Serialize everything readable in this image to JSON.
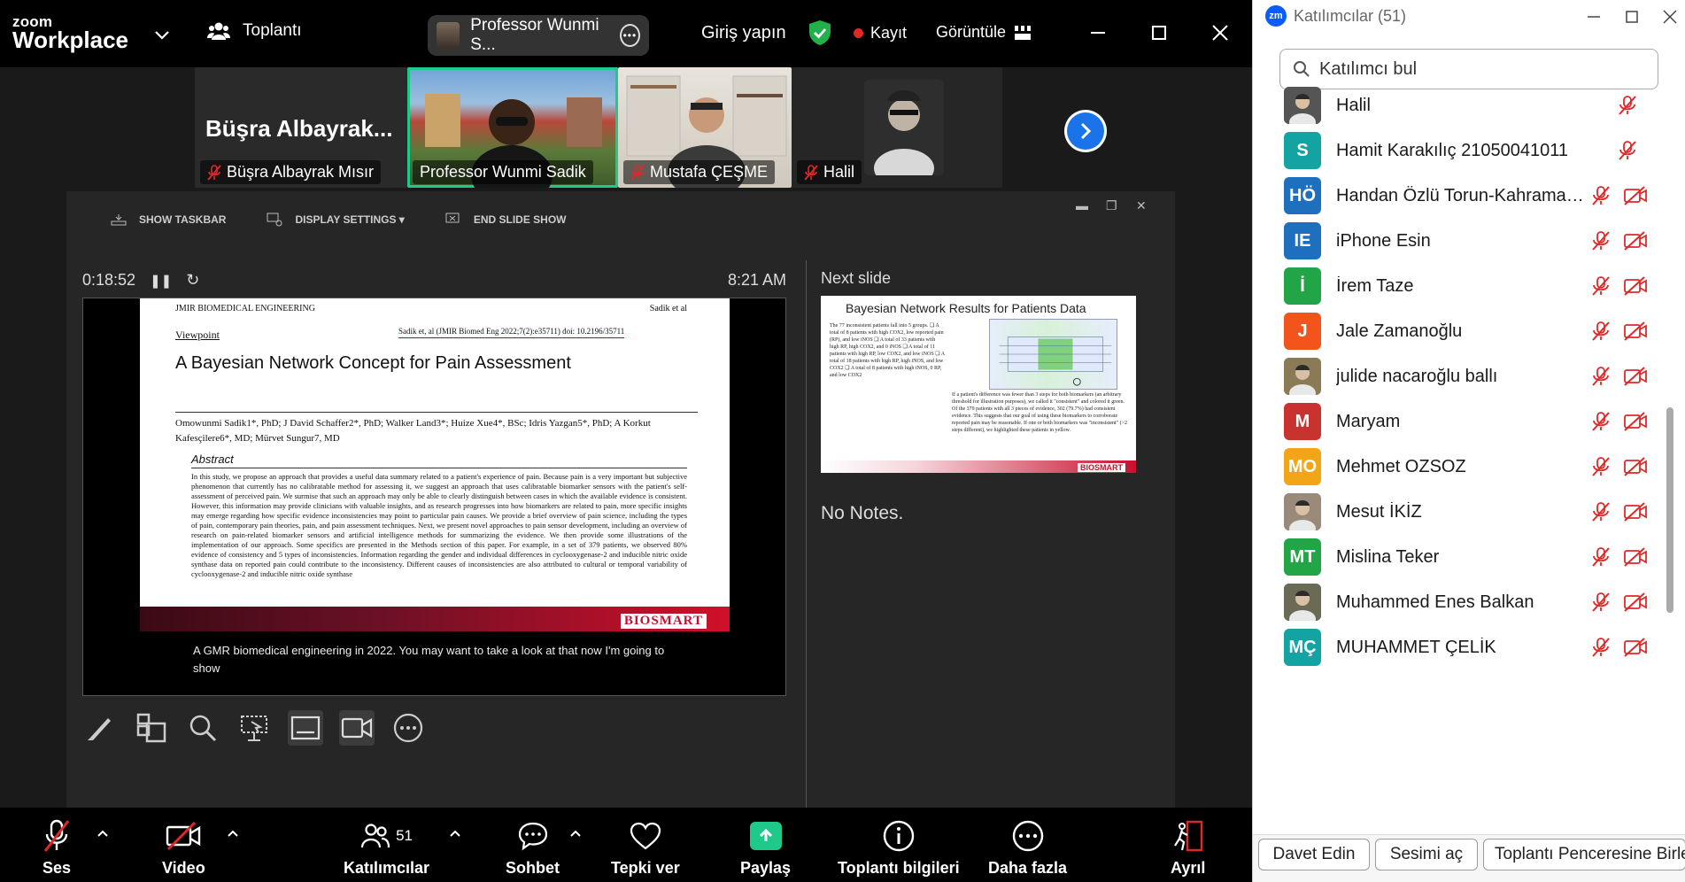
{
  "app": {
    "logo_line1": "zoom",
    "logo_line2": "Workplace",
    "meeting_label": "Toplantı",
    "speaker_pill": "Professor Wunmi S...",
    "signin": "Giriş yapın",
    "record": "Kayıt",
    "view": "Görüntüle"
  },
  "thumbnails": [
    {
      "big_name": "Büşra  Albayrak...",
      "label": "Büşra Albayrak Mısır",
      "muted": true
    },
    {
      "label": "Professor Wunmi Sadik",
      "muted": false,
      "active": true
    },
    {
      "label": "Mustafa ÇEŞME",
      "muted": true
    },
    {
      "label": "Halil",
      "muted": true
    }
  ],
  "presenter": {
    "toolbar": {
      "show_taskbar": "SHOW TASKBAR",
      "display_settings": "DISPLAY SETTINGS ▾",
      "end_slide_show": "END SLIDE SHOW"
    },
    "timer": "0:18:52",
    "clock": "8:21 AM",
    "next_label": "Next slide",
    "notes": "No Notes.",
    "caption": "A GMR biomedical engineering  in 2022. You may want to take a look at that now I'm going to show",
    "slide": {
      "journal": "JMIR BIOMEDICAL ENGINEERING",
      "header_right": "Sadik et al",
      "viewpoint": "Viewpoint",
      "citation": "Sadik et, al  (JMIR Biomed Eng 2022;7(2):e35711)  doi: 10.2196/35711",
      "title": "A Bayesian Network Concept for Pain Assessment",
      "authors": "Omowunmi Sadik1*, PhD; J David Schaffer2*, PhD; Walker Land3*; Huize Xue4*, BSc; Idris Yazgan5*, PhD; A Korkut Kafesçilere6*, MD; Mürvet Sungur7, MD",
      "abstract_heading": "Abstract",
      "abstract": "In this study, we propose an approach that provides a useful data summary related to a patient's experience of pain. Because pain is a very important but subjective phenomenon that currently has no calibratable method for assessing it, we suggest an approach that uses calibratable biomarker sensors with the patient's self-assessment of perceived pain. We surmise that such an approach may only be able to clearly distinguish between cases in which the available evidence is consistent. However, this information may provide clinicians with valuable insights, and as research progresses into how biomarkers are related to pain, more specific insights may emerge regarding how specific evidence inconsistencies may point to particular pain causes. We provide a brief overview of pain science, including the types of pain, contemporary pain theories, pain, and pain assessment techniques. Next, we present novel approaches to pain sensor development, including an overview of research on pain-related biomarker sensors and artificial intelligence methods for summarizing the evidence. We then provide some illustrations of the implementation of our approach. Some specifics are presented in the Methods section of this paper. For example, in a set of 379 patients, we observed 80% evidence of consistency and 5 types of inconsistencies. Information regarding the gender and individual differences in cyclooxygenase-2 and inducible nitric oxide synthase data on reported pain could contribute to the inconsistency. Different causes of inconsistencies are also attributed to cultural or temporal variability of cyclooxygenase-2 and inducible nitric oxide synthase",
      "brand": "BIOSMART"
    },
    "next_slide": {
      "title": "Bayesian Network Results for Patients Data",
      "list": "The 77 inconsistent patients fall into 5 groups. ❑ A total of 8 patients with high COX2, low reported pain (RP), and low iNOS ❑ A total of 33 patients with high RP, high COX2, and 0 iNOS ❑ A total of 11 patients with high RP, low COX2, and low iNOS ❑ A total of 18 patients with high RP, high iNOS, and low COX2 ❑ A total of 8 patients with high iNOS, 0 RP, and low COX2",
      "text": "If a patient's difference was fewer than 3 steps for both biomarkers (an arbitrary threshold for illustration purposes), we called it \"consistent\" and colored it green. Of the 379 patients with all 3 pieces of evidence, 302 (79.7%) had consistent evidence. This suggests that our goal of using these biomarkers to corroborate reported pain may be reasonable. If one or both biomarkers was \"inconsistent\" (>2 steps different), we highlighted these patients in yellow.",
      "brand": "BIOSMART"
    }
  },
  "bottom_bar": {
    "audio": "Ses",
    "video": "Video",
    "participants": "Katılımcılar",
    "participants_count": "51",
    "chat": "Sohbet",
    "react": "Tepki ver",
    "share": "Paylaş",
    "info": "Toplantı bilgileri",
    "more": "Daha fazla",
    "leave": "Ayrıl"
  },
  "participants_panel": {
    "title": "Katılımcılar (51)",
    "search_placeholder": "Katılımcı bul",
    "list": [
      {
        "name": "Halil",
        "initials": "",
        "color": "#555555",
        "photo": true,
        "cam_off": false
      },
      {
        "name": "Hamit Karakılıç 21050041011",
        "initials": "S",
        "color": "#13a3a3",
        "photo": false,
        "cam_off": false
      },
      {
        "name": "Handan Özlü Torun-Kahraman...",
        "initials": "HÖ",
        "color": "#1f6fbf",
        "photo": false,
        "cam_off": true
      },
      {
        "name": "iPhone Esin",
        "initials": "IE",
        "color": "#1f6fbf",
        "photo": false,
        "cam_off": true
      },
      {
        "name": "İrem Taze",
        "initials": "İ",
        "color": "#22a547",
        "photo": false,
        "cam_off": true
      },
      {
        "name": "Jale Zamanoğlu",
        "initials": "J",
        "color": "#f2541b",
        "photo": false,
        "cam_off": true
      },
      {
        "name": "julide nacaroğlu ballı",
        "initials": "",
        "color": "#8a7a55",
        "photo": true,
        "cam_off": true
      },
      {
        "name": "Maryam",
        "initials": "M",
        "color": "#c8332f",
        "photo": false,
        "cam_off": true
      },
      {
        "name": "Mehmet OZSOZ",
        "initials": "MO",
        "color": "#f2a516",
        "photo": false,
        "cam_off": true
      },
      {
        "name": "Mesut İKİZ",
        "initials": "",
        "color": "#9a8a7a",
        "photo": true,
        "cam_off": true
      },
      {
        "name": "Mislina Teker",
        "initials": "MT",
        "color": "#22a547",
        "photo": false,
        "cam_off": true
      },
      {
        "name": "Muhammed Enes Balkan",
        "initials": "",
        "color": "#6a6a55",
        "photo": true,
        "cam_off": true
      },
      {
        "name": "MUHAMMET ÇELİK",
        "initials": "MÇ",
        "color": "#13a3a3",
        "photo": false,
        "cam_off": true
      }
    ],
    "footer": {
      "invite": "Davet Edin",
      "unmute": "Sesimi aç",
      "meeting_window": "Toplantı Penceresine Birleştir"
    }
  },
  "colors": {
    "accent_green": "#1ec98a",
    "zoom_blue": "#0b5cff",
    "muted_red": "#e02828"
  }
}
